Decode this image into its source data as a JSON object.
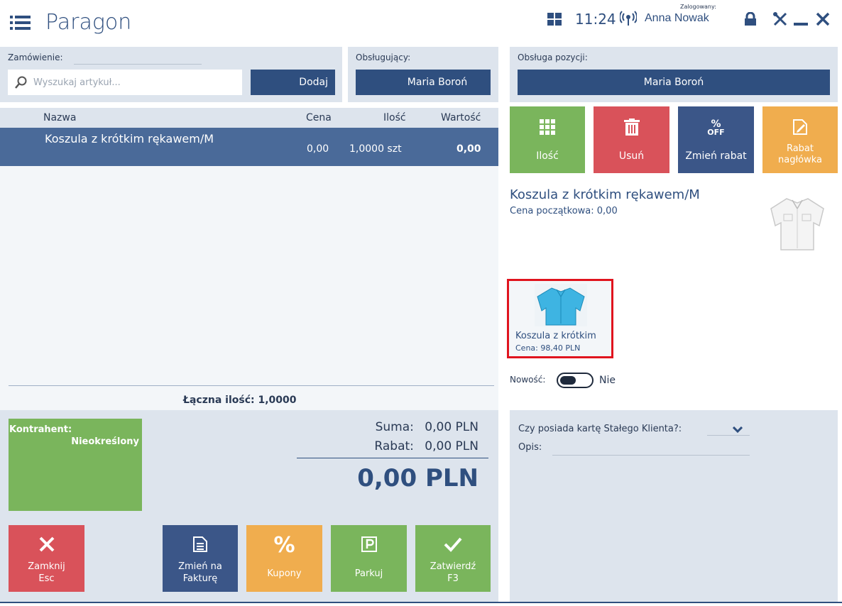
{
  "header": {
    "title": "Paragon",
    "time": "11:24",
    "logged_label": "Zalogowany:",
    "user": "Anna Nowak"
  },
  "order": {
    "label": "Zamówienie:",
    "search_placeholder": "Wyszukaj artykuł...",
    "add_label": "Dodaj"
  },
  "served": {
    "label": "Obsługujący:",
    "value": "Maria Boroń"
  },
  "position_service": {
    "label": "Obsługa pozycji:",
    "value": "Maria Boroń"
  },
  "table": {
    "headers": {
      "name": "Nazwa",
      "price": "Cena",
      "qty": "Ilość",
      "value": "Wartość"
    },
    "rows": [
      {
        "name": "Koszula z krótkim rękawem/M",
        "price": "0,00",
        "qty": "1,0000 szt",
        "value": "0,00"
      }
    ],
    "total_label": "Łączna ilość:",
    "total_value": "1,0000"
  },
  "actions": {
    "qty": "Ilość",
    "delete": "Usuń",
    "discount_icon": "%",
    "discount_icon_sub": "OFF",
    "discount": "Zmień rabat",
    "header_discount_1": "Rabat",
    "header_discount_2": "nagłówka"
  },
  "details": {
    "name": "Koszula z krótkim rękawem/M",
    "initial_price": "Cena początkowa: 0,00",
    "card_name": "Koszula z krótkim",
    "card_price": "Cena: 98,40 PLN",
    "new_label": "Nowość:",
    "new_value": "Nie"
  },
  "contractor": {
    "label": "Kontrahent:",
    "value": "Nieokreślony"
  },
  "summary": {
    "sum_label": "Suma:",
    "sum_value": "0,00 PLN",
    "discount_label": "Rabat:",
    "discount_value": "0,00 PLN",
    "total": "0,00 PLN"
  },
  "bottom": {
    "close_1": "Zamknij",
    "close_2": "Esc",
    "invoice_1": "Zmień na",
    "invoice_2": "Fakturę",
    "coupons": "Kupony",
    "park": "Parkuj",
    "confirm_1": "Zatwierdź",
    "confirm_2": "F3"
  },
  "attributes": {
    "loyalty_label": "Czy posiada kartę Stałego Klienta?:",
    "description_label": "Opis:"
  },
  "colors": {
    "navy": "#2f4f7f",
    "green": "#7ab55c",
    "red": "#d9525a",
    "orange": "#f0ad4e",
    "panel": "#dde4ed",
    "highlight": "#e0141e"
  }
}
